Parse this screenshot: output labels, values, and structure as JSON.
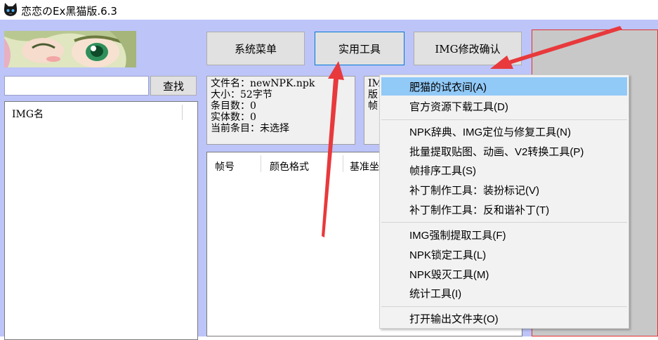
{
  "window": {
    "title": "恋恋のEx黑猫版.6.3",
    "icon": "black-cat-app-icon"
  },
  "search": {
    "value": "",
    "button_label": "查找"
  },
  "img_list": {
    "column_header": "IMG名"
  },
  "toolbar": {
    "system_menu_label": "系统菜单",
    "tools_label": "实用工具",
    "img_confirm_label": "IMG修改确认"
  },
  "file_info": {
    "filename": "文件名：newNPK.npk",
    "size": "大小：52字节",
    "entry_count": "条目数：0",
    "entity_count": "实体数：0",
    "current_entry": "当前条目：未选择"
  },
  "img_info": {
    "line1": "IM",
    "line2": "版",
    "line3": "帧"
  },
  "frame_list": {
    "columns": [
      "帧号",
      "颜色格式",
      "基准坐"
    ]
  },
  "tools_menu": {
    "groups": [
      [
        {
          "label": "肥猫的试衣间(A)",
          "highlighted": true
        },
        {
          "label": "官方资源下载工具(D)",
          "highlighted": false
        }
      ],
      [
        {
          "label": "NPK辞典、IMG定位与修复工具(N)",
          "highlighted": false
        },
        {
          "label": "批量提取贴图、动画、V2转换工具(P)",
          "highlighted": false
        },
        {
          "label": "帧排序工具(S)",
          "highlighted": false
        },
        {
          "label": "补丁制作工具：装扮标记(V)",
          "highlighted": false
        },
        {
          "label": "补丁制作工具：反和谐补丁(T)",
          "highlighted": false
        }
      ],
      [
        {
          "label": "IMG强制提取工具(F)",
          "highlighted": false
        },
        {
          "label": "NPK锁定工具(L)",
          "highlighted": false
        },
        {
          "label": "NPK毁灭工具(M)",
          "highlighted": false
        },
        {
          "label": "统计工具(I)",
          "highlighted": false
        }
      ],
      [
        {
          "label": "打开输出文件夹(O)",
          "highlighted": false
        }
      ]
    ]
  },
  "colors": {
    "client_bg": "#bcc4f8",
    "menu_highlight": "#91c9f7",
    "annotation_arrow": "#e8393c"
  }
}
